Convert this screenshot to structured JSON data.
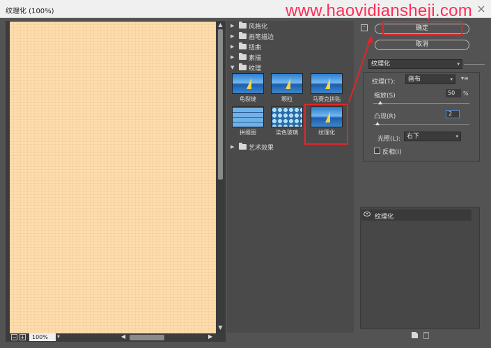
{
  "window": {
    "title": "纹理化 (100%)",
    "watermark": "www.haovidiansheji.com",
    "close_glyph": "×"
  },
  "colors": {
    "highlight": "#e0262b",
    "preview": "#ffdcab",
    "accent": "#ff2d55"
  },
  "preview": {
    "zoom": "100%"
  },
  "gallery": {
    "categories_top": [
      "风格化",
      "画笔描边",
      "扭曲",
      "素描"
    ],
    "expanded_category": "纹理",
    "filters": [
      {
        "label": "龟裂缝",
        "icon": "craquelure-thumbnail"
      },
      {
        "label": "颗粒",
        "icon": "grain-thumbnail"
      },
      {
        "label": "马赛克拼贴",
        "icon": "mosaic-tiles-thumbnail"
      },
      {
        "label": "拼缀图",
        "icon": "patchwork-thumbnail"
      },
      {
        "label": "染色玻璃",
        "icon": "stained-glass-thumbnail"
      },
      {
        "label": "纹理化",
        "icon": "texturizer-thumbnail"
      }
    ],
    "selected": "纹理化",
    "categories_bottom": [
      "艺术效果"
    ]
  },
  "buttons": {
    "ok": "确定",
    "cancel": "取消"
  },
  "filter_select": "纹理化",
  "params": {
    "texture_label": "纹理(T):",
    "texture_value": "画布",
    "scale_label": "缩放(S)",
    "scale_value": "50",
    "scale_unit": "%",
    "scale_fraction": 0.07,
    "relief_label": "凸现(R)",
    "relief_value": "2",
    "relief_fraction": 0.04,
    "light_label": "光照(L):",
    "light_value": "右下",
    "invert_label": "反相(I)"
  },
  "layers": [
    {
      "name": "纹理化",
      "visible": true
    }
  ]
}
